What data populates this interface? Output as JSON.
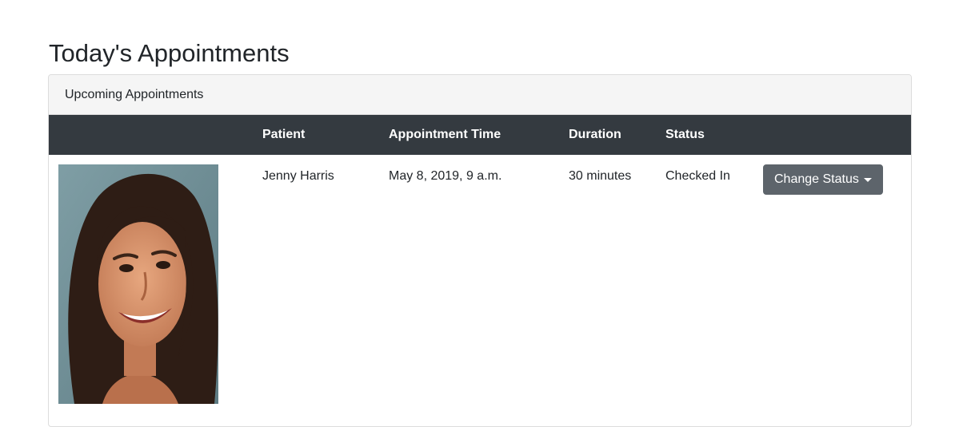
{
  "page": {
    "title": "Today's Appointments"
  },
  "card": {
    "header": "Upcoming Appointments"
  },
  "table": {
    "columns": [
      "",
      "Patient",
      "Appointment Time",
      "Duration",
      "Status",
      ""
    ],
    "rows": [
      {
        "photo_icon": "patient-photo",
        "patient": "Jenny Harris",
        "appointment_time": "May 8, 2019, 9 a.m.",
        "duration": "30 minutes",
        "status": "Checked In",
        "action_label": "Change Status",
        "action_icon": "caret-down-icon"
      }
    ]
  },
  "colors": {
    "header_bg": "#343a40",
    "button_bg": "#5d646b",
    "card_header_bg": "#f5f5f5"
  }
}
